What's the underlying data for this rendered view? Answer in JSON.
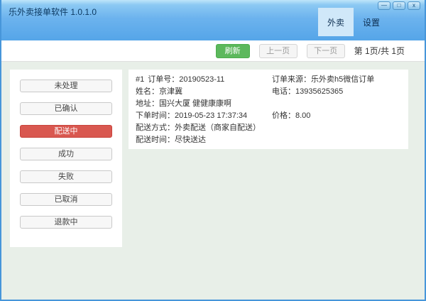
{
  "window": {
    "title": "乐外卖接单软件 1.0.1.0",
    "controls": {
      "minimize": "—",
      "maximize": "□",
      "close": "x"
    }
  },
  "tabs": [
    {
      "label": "外卖",
      "active": true
    },
    {
      "label": "设置",
      "active": false
    }
  ],
  "toolbar": {
    "refresh_label": "刷新",
    "prev_label": "上一页",
    "next_label": "下一页",
    "page_info": "第 1页/共 1页"
  },
  "sidebar": {
    "items": [
      {
        "label": "未处理",
        "active": false
      },
      {
        "label": "已确认",
        "active": false
      },
      {
        "label": "配送中",
        "active": true
      },
      {
        "label": "成功",
        "active": false
      },
      {
        "label": "失败",
        "active": false
      },
      {
        "label": "已取消",
        "active": false
      },
      {
        "label": "退款中",
        "active": false
      }
    ]
  },
  "order": {
    "index": "#1",
    "order_no_label": "订单号：",
    "order_no": "20190523-11",
    "source_label": "订单来源：",
    "source": "乐外卖h5微信订单",
    "name_label": "姓名：",
    "name": "京津冀",
    "phone_label": "电话：",
    "phone": "13935625365",
    "address_label": "地址：",
    "address": "国兴大厦 健健康康啊",
    "order_time_label": "下单时间：",
    "order_time": "2019-05-23 17:37:34",
    "price_label": "价格：",
    "price": "8.00",
    "delivery_method_label": "配送方式：",
    "delivery_method": "外卖配送（商家自配送）",
    "delivery_time_label": "配送时间：",
    "delivery_time": "尽快送达"
  },
  "colors": {
    "titlebar_blue": "#55a5e8",
    "active_tab_bg": "#d0e8f9",
    "refresh_green": "#5cb85c",
    "active_status_red": "#d95850",
    "content_bg": "#e8efe8"
  }
}
